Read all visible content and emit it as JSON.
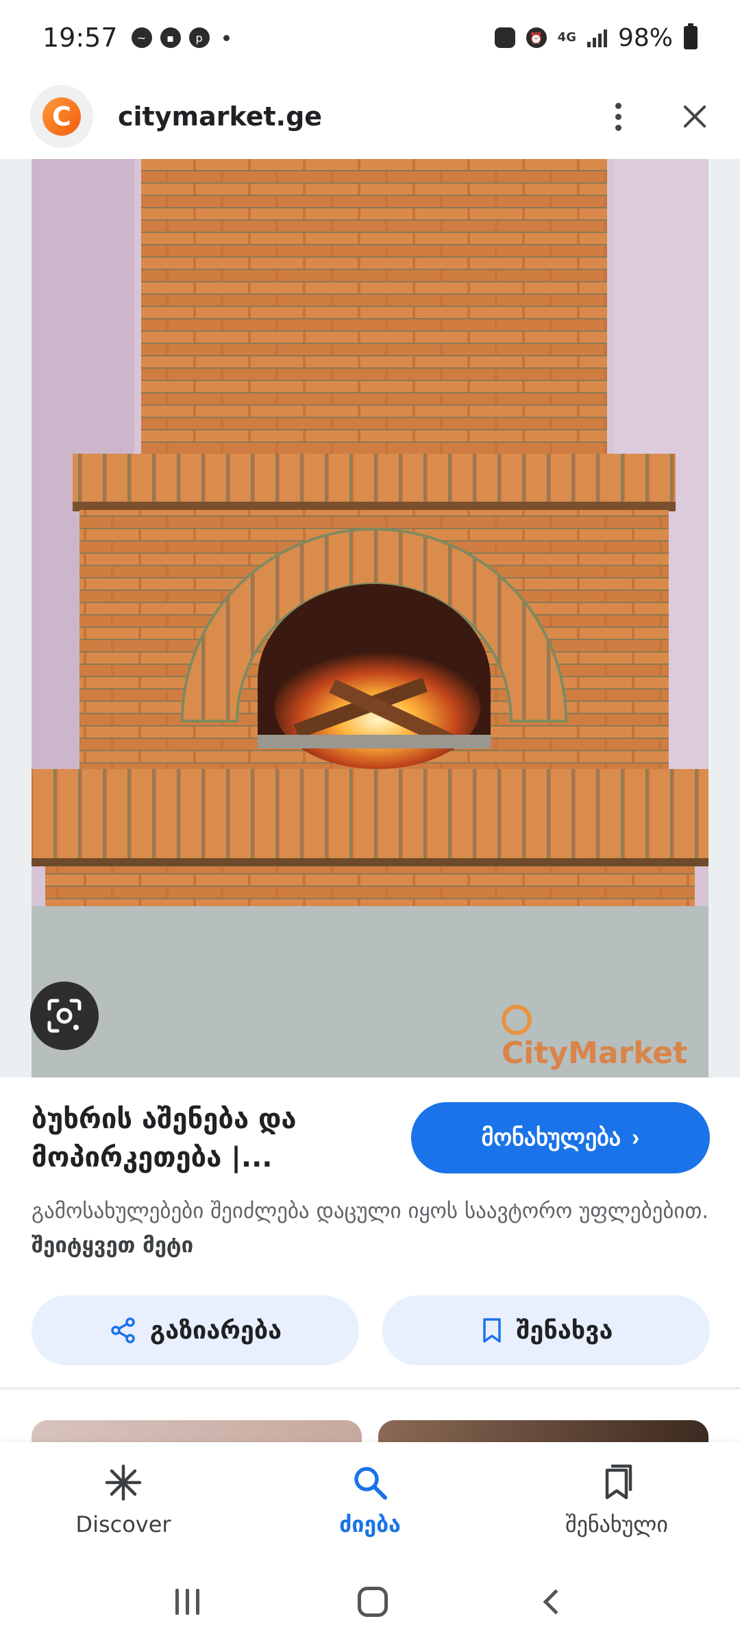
{
  "status_bar": {
    "time": "19:57",
    "network": "4G",
    "battery": "98%"
  },
  "header": {
    "site_name": "citymarket.ge",
    "logo_letter": "C"
  },
  "image": {
    "watermark": "CityMarket"
  },
  "result": {
    "title_line1": "ბუხრის აშენება და",
    "title_line2": "მოპირკეთება |...",
    "visit_label": "მონახულება",
    "visit_chevron": "›",
    "copyright_text": "გამოსახულებები შეიძლება დაცული იყოს საავტორო უფლებებით.",
    "learn_more": "შეიტყვეთ მეტი"
  },
  "actions": {
    "share_label": "გაზიარება",
    "save_label": "შენახვა"
  },
  "bottom_nav": {
    "discover": "Discover",
    "search": "ძიება",
    "saved": "შენახული"
  },
  "colors": {
    "accent": "#1a73e8",
    "chip_bg": "#e8f0fe",
    "brick": "#c8733a"
  }
}
